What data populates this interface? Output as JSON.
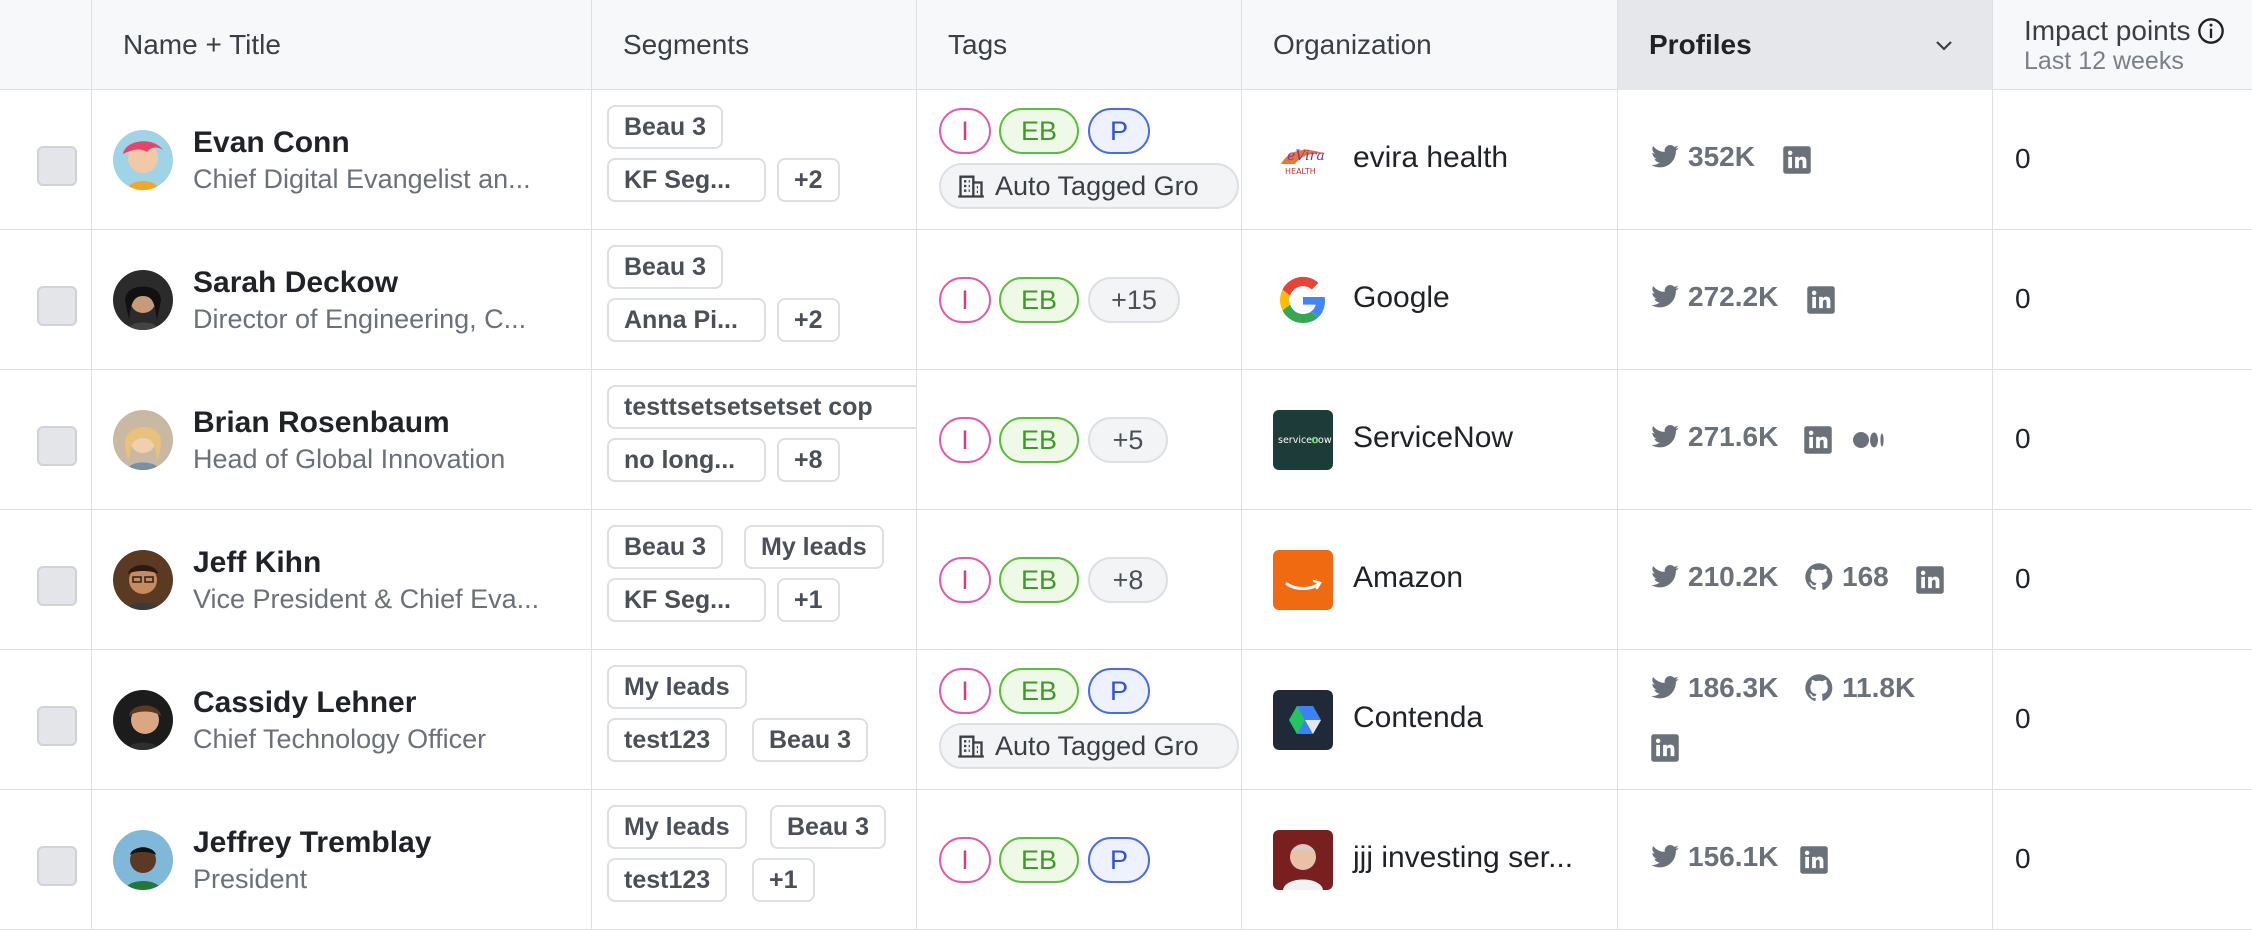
{
  "header": {
    "name_title": "Name + Title",
    "segments": "Segments",
    "tags": "Tags",
    "organization": "Organization",
    "profiles": "Profiles",
    "impact_title": "Impact points",
    "impact_sub": "Last 12 weeks"
  },
  "colors": {
    "tag_I": "#e45ca9",
    "tag_EB": "#5bbe3a",
    "tag_P": "#4b6be8",
    "sorted_header_bg": "#e6e7ea"
  },
  "rows": [
    {
      "name": "Evan Conn",
      "title": "Chief Digital Evangelist an...",
      "segments": [
        "Beau 3",
        "KF Seg...",
        "+2"
      ],
      "tags": [
        "I",
        "EB",
        "P",
        "Auto Tagged Gro"
      ],
      "org": "evira health",
      "profiles": {
        "twitter": "352K",
        "linkedin": "linkedin-icon"
      },
      "impact": "0"
    },
    {
      "name": "Sarah Deckow",
      "title": "Director of Engineering, C...",
      "segments": [
        "Beau 3",
        "Anna Pi...",
        "+2"
      ],
      "tags": [
        "I",
        "EB",
        "+15"
      ],
      "org": "Google",
      "profiles": {
        "twitter": "272.2K",
        "linkedin": "linkedin-icon"
      },
      "impact": "0"
    },
    {
      "name": "Brian Rosenbaum",
      "title": "Head of Global Innovation",
      "segments": [
        "testtsetsetsetset cop",
        "no long...",
        "+8"
      ],
      "tags": [
        "I",
        "EB",
        "+5"
      ],
      "org": "ServiceNow",
      "profiles": {
        "twitter": "271.6K",
        "linkedin": "linkedin-icon",
        "medium": "medium-icon"
      },
      "impact": "0"
    },
    {
      "name": "Jeff Kihn",
      "title": "Vice President & Chief Eva...",
      "segments": [
        "Beau 3",
        "My leads",
        "KF Seg...",
        "+1"
      ],
      "tags": [
        "I",
        "EB",
        "+8"
      ],
      "org": "Amazon",
      "profiles": {
        "twitter": "210.2K",
        "github": "168",
        "linkedin": "linkedin-icon"
      },
      "impact": "0"
    },
    {
      "name": "Cassidy Lehner",
      "title": "Chief Technology Officer",
      "segments": [
        "My leads",
        "test123",
        "Beau 3"
      ],
      "tags": [
        "I",
        "EB",
        "P",
        "Auto Tagged Gro"
      ],
      "org": "Contenda",
      "profiles": {
        "twitter": "186.3K",
        "github": "11.8K",
        "linkedin": "linkedin-icon"
      },
      "impact": "0"
    },
    {
      "name": "Jeffrey Tremblay",
      "title": "President",
      "segments": [
        "My leads",
        "Beau 3",
        "test123",
        "+1"
      ],
      "tags": [
        "I",
        "EB",
        "P"
      ],
      "org": "jjj investing ser...",
      "profiles": {
        "twitter": "156.1K",
        "linkedin": "linkedin-icon"
      },
      "impact": "0"
    }
  ]
}
